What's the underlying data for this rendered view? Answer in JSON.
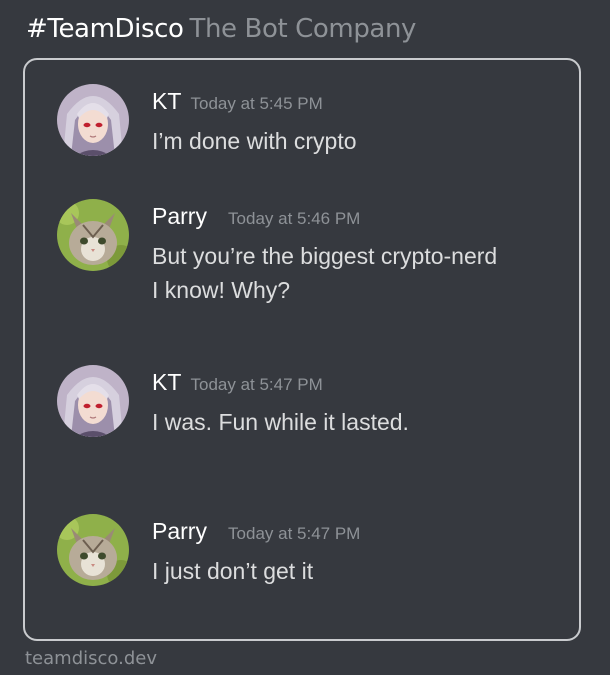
{
  "header": {
    "brand": "#TeamDisco",
    "company": "The Bot Company"
  },
  "messages": [
    {
      "author": "KT",
      "time": "Today at 5:45 PM",
      "lines": [
        "I’m done with crypto"
      ],
      "avatar": "anime-girl-avatar"
    },
    {
      "author": "Parry",
      "time": "Today at 5:46 PM",
      "lines": [
        "But you’re the biggest crypto-nerd",
        "I know!  Why?"
      ],
      "avatar": "kitten-avatar"
    },
    {
      "author": "KT",
      "time": "Today at 5:47 PM",
      "lines": [
        "I was.  Fun while it lasted."
      ],
      "avatar": "anime-girl-avatar"
    },
    {
      "author": "Parry",
      "time": "Today at 5:47 PM",
      "lines": [
        "I just don’t get it"
      ],
      "avatar": "kitten-avatar"
    }
  ],
  "footer": {
    "url": "teamdisco.dev"
  },
  "colors": {
    "background": "#36393f",
    "frame_border": "#c9cbce",
    "muted_text": "#8e9297",
    "message_text": "#dcddde"
  }
}
